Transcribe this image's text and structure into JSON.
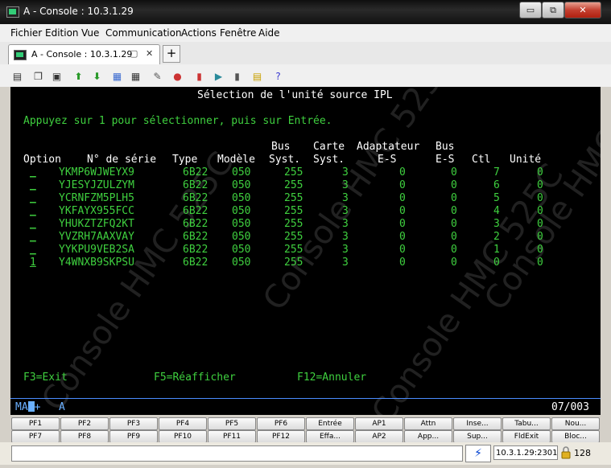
{
  "window": {
    "title": "A - Console : 10.3.1.29",
    "close_symbol": "✕",
    "min_symbol": "▭",
    "max_symbol": "⧉"
  },
  "menu": [
    "Fichier",
    "Edition",
    "Vue",
    "Communication",
    "Actions",
    "Fenêtre",
    "Aide"
  ],
  "tab": {
    "label": "A - Console : 10.3.1.29",
    "new_tab": "+"
  },
  "toolbar_icons": [
    "print-screen",
    "copy",
    "paste",
    "send-file",
    "receive-file",
    "macro-play",
    "keypad",
    "record-macro",
    "stop",
    "disconnect",
    "connect",
    "transfer",
    "clear",
    "notes",
    "help"
  ],
  "terminal": {
    "title": "Sélection de l'unité source IPL",
    "instruction": "Appuyez sur 1 pour sélectionner, puis sur Entrée.",
    "header1": {
      "bus": "Bus",
      "carte": "Carte",
      "adaptateur": "Adaptateur",
      "bus2": "Bus"
    },
    "header2": {
      "option": "Option",
      "serie": "N° de série",
      "type": "Type",
      "modele": "Modèle",
      "bus": "Syst.",
      "carte": "Syst.",
      "adaptateur": "E-S",
      "bus2": "E-S",
      "ctl": "Ctl",
      "unite": "Unité"
    },
    "rows": [
      {
        "opt": "_",
        "serial": "YKMP6WJWEYX9",
        "type": "6B22",
        "model": "050",
        "bus": "255",
        "carte": "3",
        "adapt": "0",
        "bus2": "0",
        "ctl": "7",
        "unit": "0"
      },
      {
        "opt": "_",
        "serial": "YJESYJZULZYM",
        "type": "6B22",
        "model": "050",
        "bus": "255",
        "carte": "3",
        "adapt": "0",
        "bus2": "0",
        "ctl": "6",
        "unit": "0"
      },
      {
        "opt": "_",
        "serial": "YCRNFZM5PLH5",
        "type": "6B22",
        "model": "050",
        "bus": "255",
        "carte": "3",
        "adapt": "0",
        "bus2": "0",
        "ctl": "5",
        "unit": "0"
      },
      {
        "opt": "_",
        "serial": "YKFAYX955FCC",
        "type": "6B22",
        "model": "050",
        "bus": "255",
        "carte": "3",
        "adapt": "0",
        "bus2": "0",
        "ctl": "4",
        "unit": "0"
      },
      {
        "opt": "_",
        "serial": "YHUKZTZFQ2KT",
        "type": "6B22",
        "model": "050",
        "bus": "255",
        "carte": "3",
        "adapt": "0",
        "bus2": "0",
        "ctl": "3",
        "unit": "0"
      },
      {
        "opt": "_",
        "serial": "YVZRH7AAXVAY",
        "type": "6B22",
        "model": "050",
        "bus": "255",
        "carte": "3",
        "adapt": "0",
        "bus2": "0",
        "ctl": "2",
        "unit": "0"
      },
      {
        "opt": "_",
        "serial": "YYKPU9VEB2SA",
        "type": "6B22",
        "model": "050",
        "bus": "255",
        "carte": "3",
        "adapt": "0",
        "bus2": "0",
        "ctl": "1",
        "unit": "0"
      },
      {
        "opt": "1",
        "serial": "Y4WNXB9SKPSU",
        "type": "6B22",
        "model": "050",
        "bus": "255",
        "carte": "3",
        "adapt": "0",
        "bus2": "0",
        "ctl": "0",
        "unit": "0"
      }
    ],
    "fkeys": {
      "f3": "F3=Exit",
      "f5": "F5=Réafficher",
      "f12": "F12=Annuler"
    },
    "status_left": "MA",
    "status_plus": "+",
    "status_mode": "A",
    "status_pos": "07/003",
    "watermark": "Console HMC 525C"
  },
  "pf_row1": [
    "PF1",
    "PF2",
    "PF3",
    "PF4",
    "PF5",
    "PF6",
    "Entrée",
    "AP1",
    "Attn",
    "Inse...",
    "Tabu...",
    "Nou..."
  ],
  "pf_row2": [
    "PF7",
    "PF8",
    "PF9",
    "PF10",
    "PF11",
    "PF12",
    "Effa...",
    "AP2",
    "App...",
    "Sup...",
    "FldExit",
    "Bloc..."
  ],
  "bottom": {
    "address": "10.3.1.29:2301",
    "code_page": "128"
  },
  "colors": {
    "terminal_bg": "#000000",
    "terminal_green": "#3fd03f",
    "terminal_white": "#ffffff",
    "status_blue": "#6ab0ff"
  }
}
